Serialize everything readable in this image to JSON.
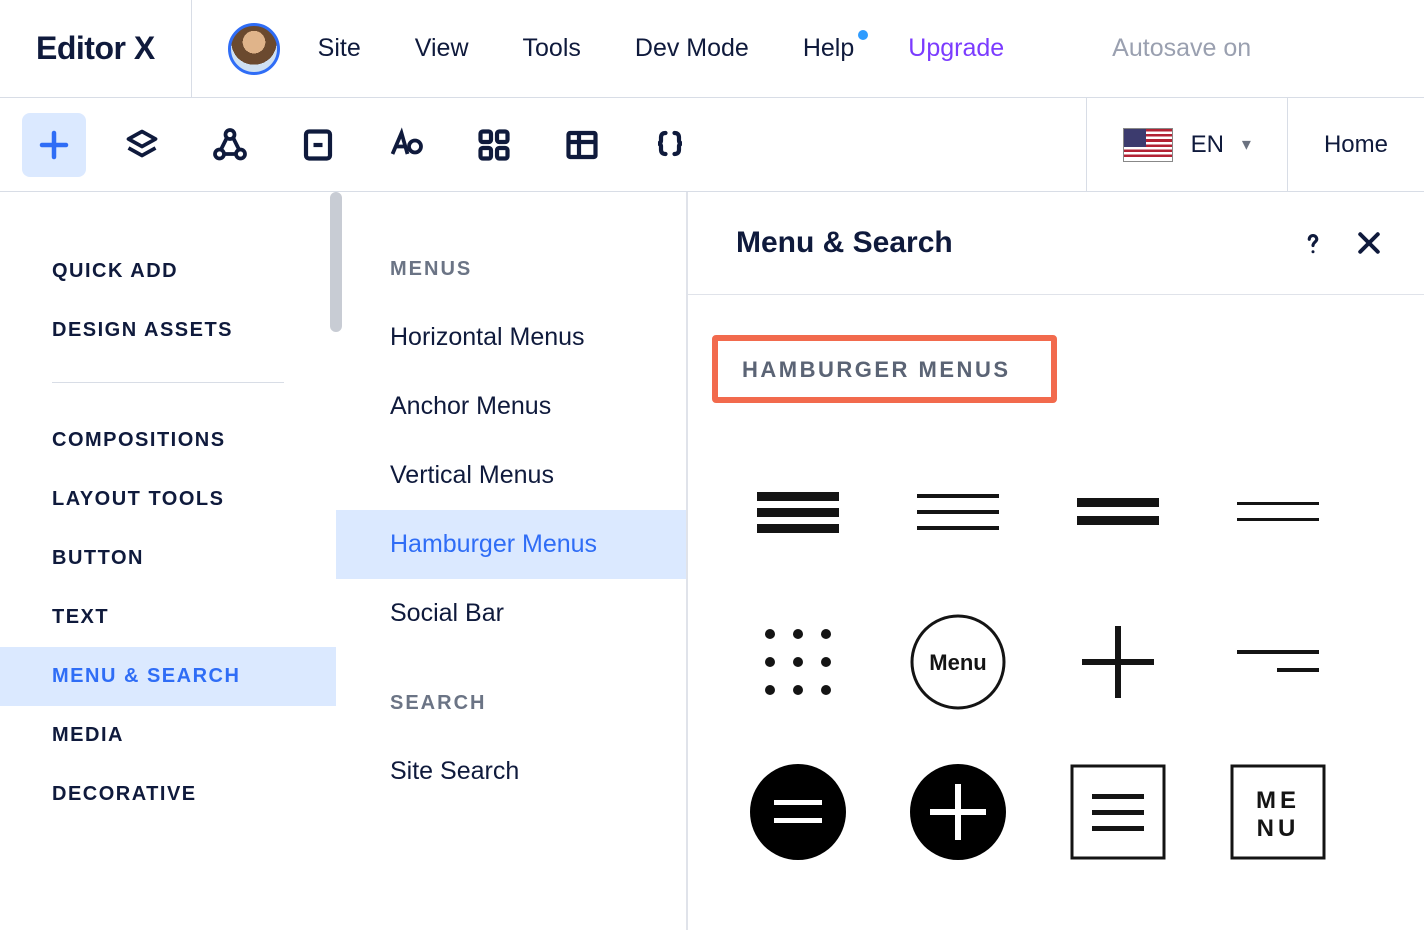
{
  "logo": "Editor X",
  "topmenu": {
    "site": "Site",
    "view": "View",
    "tools": "Tools",
    "devmode": "Dev Mode",
    "help": "Help",
    "upgrade": "Upgrade",
    "autosave": "Autosave on"
  },
  "lang": {
    "code": "EN"
  },
  "home": "Home",
  "col1": {
    "quick_add": "QUICK ADD",
    "design_assets": "DESIGN ASSETS",
    "compositions": "COMPOSITIONS",
    "layout_tools": "LAYOUT TOOLS",
    "button": "BUTTON",
    "text": "TEXT",
    "menu_search": "MENU & SEARCH",
    "media": "MEDIA",
    "decorative": "DECORATIVE"
  },
  "col2": {
    "menus_header": "MENUS",
    "horizontal": "Horizontal Menus",
    "anchor": "Anchor Menus",
    "vertical": "Vertical Menus",
    "hamburger": "Hamburger Menus",
    "social": "Social Bar",
    "search_header": "SEARCH",
    "site_search": "Site Search"
  },
  "panel": {
    "title": "Menu & Search",
    "section": "HAMBURGER MENUS",
    "menu_text": "Menu",
    "menu_stacked": "ME NU"
  }
}
